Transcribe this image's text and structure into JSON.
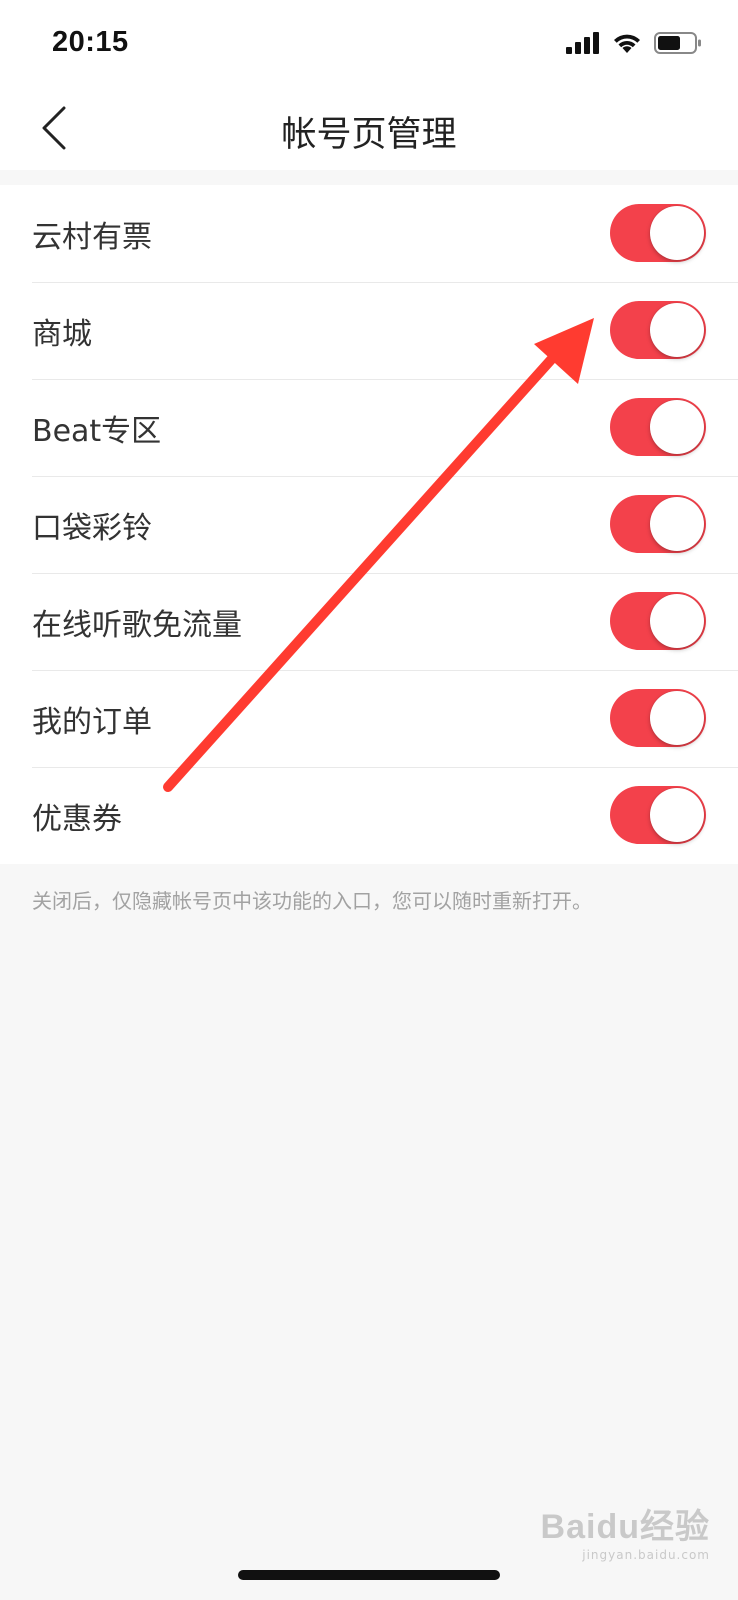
{
  "status_bar": {
    "time": "20:15",
    "icons": [
      "signal-icon",
      "wifi-icon",
      "battery-icon"
    ]
  },
  "nav": {
    "title": "帐号页管理",
    "back_icon": "chevron-left-icon"
  },
  "colors": {
    "toggle_on": "#f3414b",
    "annotation_arrow": "#ff3b30"
  },
  "settings": [
    {
      "label": "云村有票",
      "enabled": true
    },
    {
      "label": "商城",
      "enabled": true
    },
    {
      "label": "Beat专区",
      "enabled": true
    },
    {
      "label": "口袋彩铃",
      "enabled": true
    },
    {
      "label": "在线听歌免流量",
      "enabled": true
    },
    {
      "label": "我的订单",
      "enabled": true
    },
    {
      "label": "优惠券",
      "enabled": true
    }
  ],
  "footnote": "关闭后，仅隐藏帐号页中该功能的入口，您可以随时重新打开。",
  "watermark": {
    "logo": "Baidu经验",
    "sub": "jingyan.baidu.com"
  }
}
